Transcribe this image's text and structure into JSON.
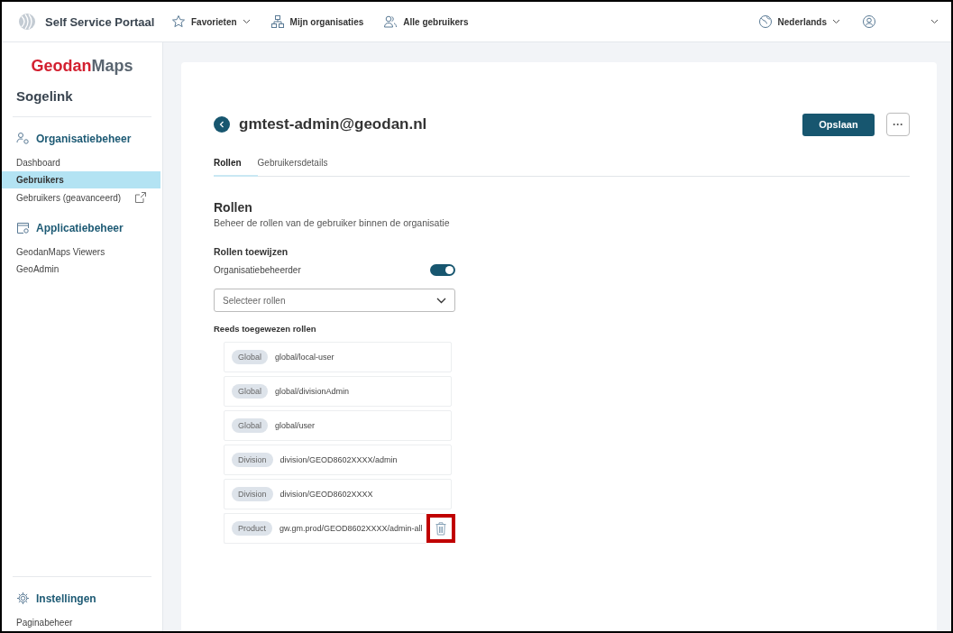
{
  "topbar": {
    "app_title": "Self Service Portaal",
    "nav": [
      {
        "label": "Favorieten",
        "dropdown": true
      },
      {
        "label": "Mijn organisaties",
        "dropdown": false
      },
      {
        "label": "Alle gebruikers",
        "dropdown": false
      }
    ],
    "language": "Nederlands"
  },
  "sidebar": {
    "logo_primary": "Geodan",
    "logo_secondary": "Maps",
    "organization": "Sogelink",
    "sections": [
      {
        "title": "Organisatiebeheer",
        "items": [
          {
            "label": "Dashboard",
            "selected": false,
            "external": false
          },
          {
            "label": "Gebruikers",
            "selected": true,
            "external": false
          },
          {
            "label": "Gebruikers (geavanceerd)",
            "selected": false,
            "external": true
          }
        ]
      },
      {
        "title": "Applicatiebeheer",
        "items": [
          {
            "label": "GeodanMaps Viewers",
            "selected": false,
            "external": false
          },
          {
            "label": "GeoAdmin",
            "selected": false,
            "external": false
          }
        ]
      }
    ],
    "footer_section": {
      "title": "Instellingen",
      "items": [
        {
          "label": "Paginabeheer",
          "selected": false,
          "external": false
        }
      ]
    }
  },
  "page": {
    "title": "gmtest-admin@geodan.nl",
    "save_button": "Opslaan",
    "more_button": "···",
    "tabs": [
      {
        "label": "Rollen",
        "selected": true
      },
      {
        "label": "Gebruikersdetails",
        "selected": false
      }
    ],
    "heading": "Rollen",
    "description": "Beheer de rollen van de gebruiker binnen de organisatie",
    "assign_label": "Rollen toewijzen",
    "toggle": {
      "label": "Organisatiebeheerder",
      "on": true
    },
    "select": {
      "placeholder": "Selecteer rollen"
    },
    "assigned_label": "Reeds toegewezen rollen",
    "roles": [
      {
        "scope": "Global",
        "name": "global/local-user",
        "delete_visible": false,
        "highlighted": false
      },
      {
        "scope": "Global",
        "name": "global/divisionAdmin",
        "delete_visible": false,
        "highlighted": false
      },
      {
        "scope": "Global",
        "name": "global/user",
        "delete_visible": false,
        "highlighted": false
      },
      {
        "scope": "Division",
        "name": "division/GEOD8602XXXX/admin",
        "delete_visible": false,
        "highlighted": false
      },
      {
        "scope": "Division",
        "name": "division/GEOD8602XXXX",
        "delete_visible": false,
        "highlighted": false
      },
      {
        "scope": "Product",
        "name": "gw.gm.prod/GEOD8602XXXX/admin-all",
        "delete_visible": true,
        "highlighted": true
      }
    ]
  }
}
